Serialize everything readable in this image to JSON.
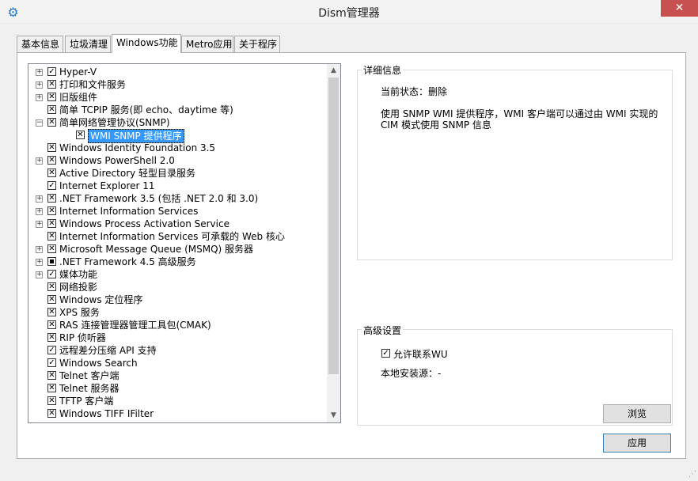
{
  "window": {
    "title": "Dism管理器",
    "close_glyph": "✕",
    "app_icon": "gear-icon"
  },
  "tabs": [
    {
      "label": "基本信息"
    },
    {
      "label": "垃圾清理"
    },
    {
      "label": "Windows功能",
      "active": true
    },
    {
      "label": "Metro应用"
    },
    {
      "label": "关于程序"
    }
  ],
  "tree": {
    "items": [
      {
        "label": "Hyper-V",
        "expander": "+",
        "state": "checked"
      },
      {
        "label": "打印和文件服务",
        "expander": "+",
        "state": "unchecked-x"
      },
      {
        "label": "旧版组件",
        "expander": "+",
        "state": "unchecked-x"
      },
      {
        "label": "简单 TCPIP 服务(即 echo、daytime 等)",
        "expander": "",
        "state": "unchecked-x"
      },
      {
        "label": "简单网络管理协议(SNMP)",
        "expander": "−",
        "state": "unchecked-x"
      },
      {
        "label": "WMI SNMP 提供程序",
        "expander": "",
        "state": "unchecked-x",
        "child": true,
        "selected": true
      },
      {
        "label": "Windows Identity Foundation 3.5",
        "expander": "",
        "state": "unchecked-x"
      },
      {
        "label": "Windows PowerShell 2.0",
        "expander": "+",
        "state": "unchecked-x"
      },
      {
        "label": "Active Directory 轻型目录服务",
        "expander": "",
        "state": "unchecked-x"
      },
      {
        "label": "Internet Explorer 11",
        "expander": "",
        "state": "checked"
      },
      {
        "label": ".NET Framework 3.5 (包括 .NET 2.0 和 3.0)",
        "expander": "+",
        "state": "unchecked-x"
      },
      {
        "label": "Internet Information Services",
        "expander": "+",
        "state": "unchecked-x"
      },
      {
        "label": "Windows Process Activation Service",
        "expander": "+",
        "state": "unchecked-x"
      },
      {
        "label": "Internet Information Services 可承载的 Web 核心",
        "expander": "",
        "state": "unchecked-x"
      },
      {
        "label": "Microsoft Message Queue (MSMQ) 服务器",
        "expander": "+",
        "state": "unchecked-x"
      },
      {
        "label": ".NET Framework 4.5 高级服务",
        "expander": "+",
        "state": "partial"
      },
      {
        "label": "媒体功能",
        "expander": "+",
        "state": "checked"
      },
      {
        "label": "网络投影",
        "expander": "",
        "state": "unchecked-x"
      },
      {
        "label": "Windows 定位程序",
        "expander": "",
        "state": "unchecked-x"
      },
      {
        "label": "XPS 服务",
        "expander": "",
        "state": "unchecked-x"
      },
      {
        "label": "RAS 连接管理器管理工具包(CMAK)",
        "expander": "",
        "state": "unchecked-x"
      },
      {
        "label": "RIP 侦听器",
        "expander": "",
        "state": "unchecked-x"
      },
      {
        "label": "远程差分压缩 API 支持",
        "expander": "",
        "state": "checked"
      },
      {
        "label": "Windows Search",
        "expander": "",
        "state": "checked"
      },
      {
        "label": "Telnet 客户端",
        "expander": "",
        "state": "unchecked-x"
      },
      {
        "label": "Telnet 服务器",
        "expander": "",
        "state": "unchecked-x"
      },
      {
        "label": "TFTP 客户端",
        "expander": "",
        "state": "unchecked-x"
      },
      {
        "label": "Windows TIFF IFilter",
        "expander": "",
        "state": "unchecked-x"
      }
    ]
  },
  "details": {
    "title": "详细信息",
    "status_label": "当前状态：",
    "status_value": "删除",
    "description_line1": "使用 SNMP WMI 提供程序，WMI 客户端可以通过由 WMI 实现的",
    "description_line2": "CIM 模式使用 SNMP 信息"
  },
  "advanced": {
    "title": "高级设置",
    "allow_wu_label": "允许联系WU",
    "allow_wu_checked": true,
    "local_source_label": "本地安装源：",
    "local_source_value": "-",
    "browse_label": "浏览"
  },
  "apply_label": "应用"
}
